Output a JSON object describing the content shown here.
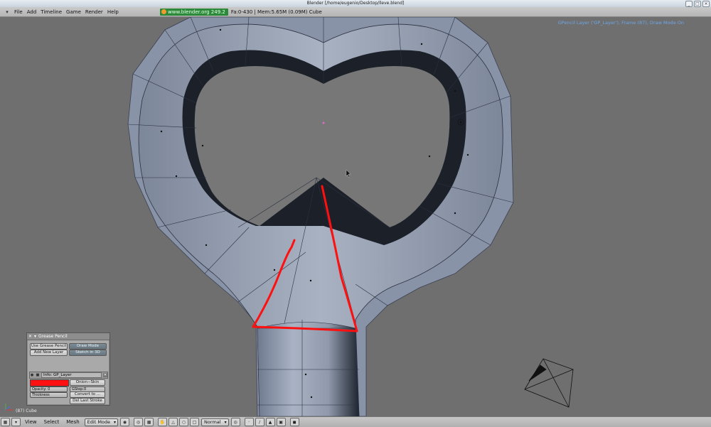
{
  "window": {
    "title": "Blender [/home/eugenio/Desktop/lleve.blend]",
    "buttons": [
      "_",
      "□",
      "×"
    ]
  },
  "menubar": {
    "items": [
      "File",
      "Add",
      "Timeline",
      "Game",
      "Render",
      "Help"
    ],
    "blender_link": "www.blender.org 249.2",
    "stats": "Fa:0-430 | Mem:5.65M (0.09M) Cube"
  },
  "viewport": {
    "gp_status": "GPencil Layer ('GP_Layer'), Frame (87), Draw Mode On",
    "frame_label": "(87) Cube"
  },
  "grease_panel": {
    "title": "Grease Pencil",
    "use_grease_pencil": "Use Grease Pencil",
    "draw_mode": "Draw Mode",
    "add_new_layer": "Add New Layer",
    "sketch_in_3d": "Sketch in 3D",
    "layer_info": "Info: GP_Layer",
    "onion_skin": "Onion−Skin",
    "opacity": "Opacity: 0",
    "gstep": "GStep:0",
    "thickness": "Thickness",
    "convert_to": "Convert to ...",
    "del_last_stroke": "Del Last Stroke",
    "color": "#ff1111"
  },
  "bottombar": {
    "view": "View",
    "select": "Select",
    "mesh": "Mesh",
    "mode": "Edit Mode",
    "pivot": "Normal"
  },
  "colors": {
    "viewport_bg": "#6f6f6f",
    "mesh": "#8d97aa",
    "stroke": "#ff1010",
    "status_text": "#6ea7e8"
  }
}
